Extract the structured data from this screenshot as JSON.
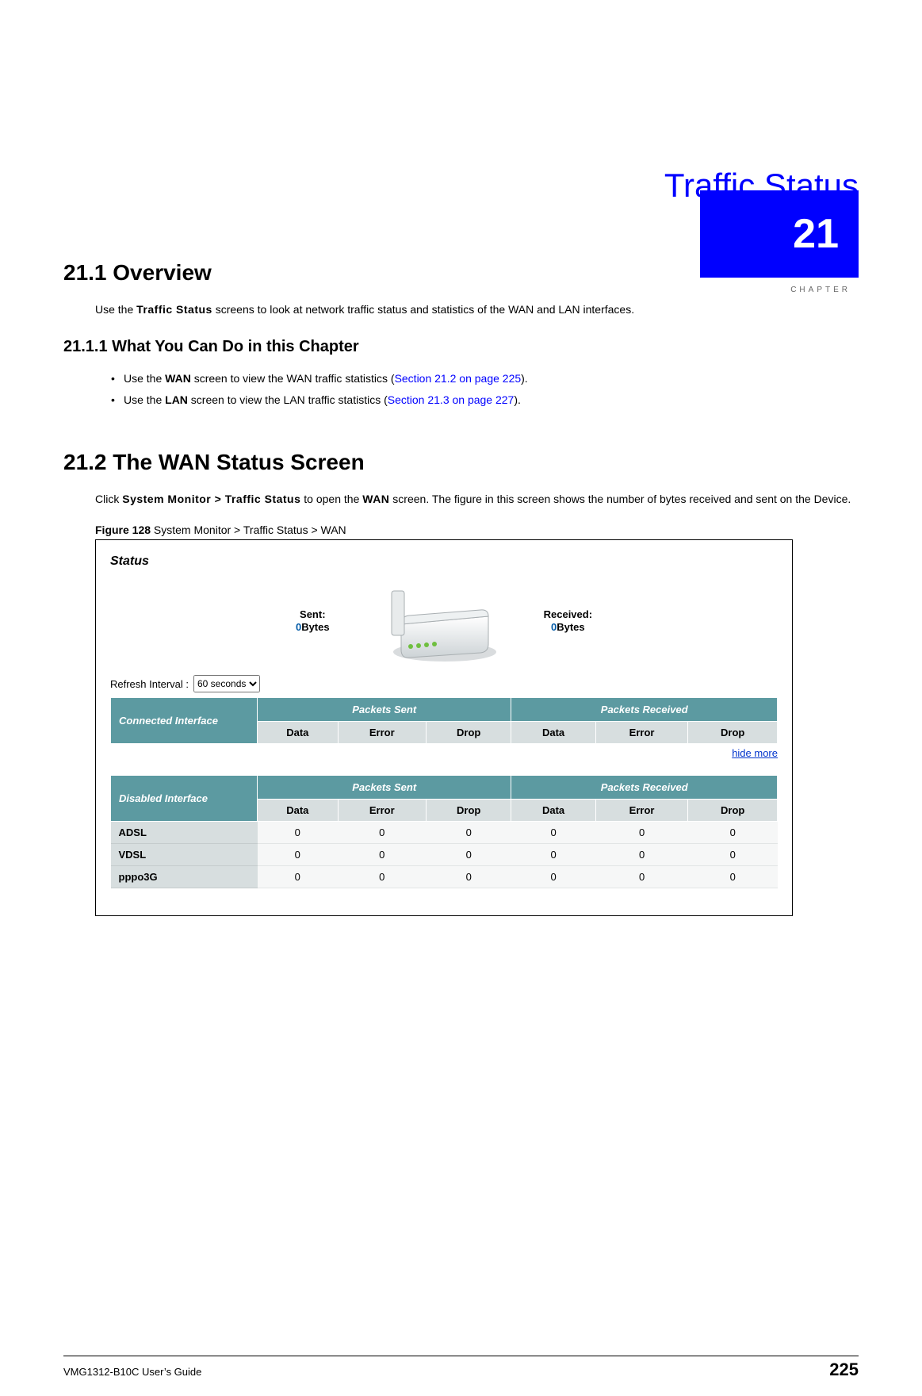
{
  "chapter": {
    "number": "21",
    "label": "CHAPTER",
    "title": "Traffic Status"
  },
  "section_overview": {
    "heading": "21.1  Overview",
    "p1_pre": "Use the ",
    "p1_bold": "Traffic Status",
    "p1_post": " screens to look at network traffic status and statistics of the WAN and LAN interfaces."
  },
  "subsection_can_do": {
    "heading": "21.1.1  What You Can Do in this Chapter",
    "b1_pre": "Use the ",
    "b1_bold": "WAN",
    "b1_mid": " screen to view the WAN traffic statistics (",
    "b1_link": "Section 21.2 on page 225",
    "b1_post": ").",
    "b2_pre": "Use the ",
    "b2_bold": "LAN",
    "b2_mid": " screen to view the LAN traffic statistics (",
    "b2_link": "Section 21.3 on page 227",
    "b2_post": ")."
  },
  "section_wan": {
    "heading": "21.2  The WAN Status Screen",
    "p1_pre": "Click ",
    "p1_bold1": "System Monitor > Traffic Status",
    "p1_mid": " to open the ",
    "p1_bold2": "WAN",
    "p1_post": " screen. The figure in this screen shows the number of bytes received and sent on the Device."
  },
  "figure": {
    "caption_label": "Figure 128",
    "caption_text": "   System Monitor > Traffic Status > WAN",
    "status_title": "Status",
    "sent_label": "Sent:",
    "sent_value": "0",
    "sent_unit": "Bytes",
    "recv_label": "Received:",
    "recv_value": "0",
    "recv_unit": "Bytes",
    "refresh_label": "Refresh Interval :",
    "refresh_option": "60 seconds",
    "hide_more": "hide more",
    "table1": {
      "corner": "Connected Interface",
      "group_sent": "Packets Sent",
      "group_recv": "Packets Received",
      "sub": [
        "Data",
        "Error",
        "Drop",
        "Data",
        "Error",
        "Drop"
      ]
    },
    "table2": {
      "corner": "Disabled Interface",
      "group_sent": "Packets Sent",
      "group_recv": "Packets Received",
      "sub": [
        "Data",
        "Error",
        "Drop",
        "Data",
        "Error",
        "Drop"
      ],
      "rows": [
        {
          "name": "ADSL",
          "vals": [
            "0",
            "0",
            "0",
            "0",
            "0",
            "0"
          ]
        },
        {
          "name": "VDSL",
          "vals": [
            "0",
            "0",
            "0",
            "0",
            "0",
            "0"
          ]
        },
        {
          "name": "pppo3G",
          "vals": [
            "0",
            "0",
            "0",
            "0",
            "0",
            "0"
          ]
        }
      ]
    }
  },
  "footer": {
    "guide": "VMG1312-B10C User’s Guide",
    "page": "225"
  }
}
